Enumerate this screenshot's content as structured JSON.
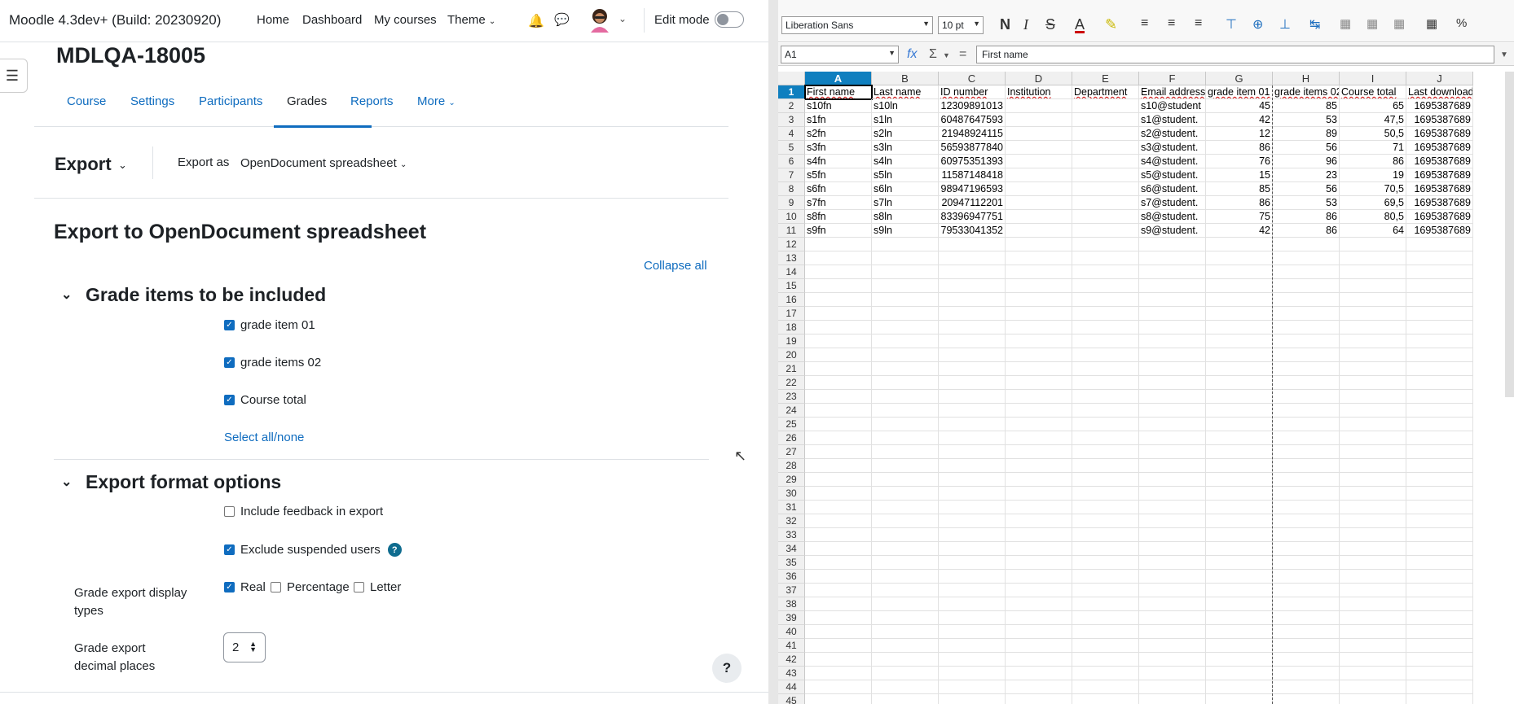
{
  "moodle": {
    "brand": "Moodle 4.3dev+ (Build: 20230920)",
    "nav": {
      "home": "Home",
      "dashboard": "Dashboard",
      "my_courses": "My courses",
      "theme": "Theme"
    },
    "edit_mode": "Edit mode",
    "course_title": "MDLQA-18005",
    "tabs": [
      "Course",
      "Settings",
      "Participants",
      "Grades",
      "Reports",
      "More"
    ],
    "active_tab": "Grades",
    "export_menu": "Export",
    "export_as_label": "Export as",
    "export_as_value": "OpenDocument spreadsheet",
    "page_heading": "Export to OpenDocument spreadsheet",
    "collapse_all": "Collapse all",
    "section_grade_items": "Grade items to be included",
    "grade_items": [
      {
        "label": "grade item 01",
        "checked": true
      },
      {
        "label": "grade items 02",
        "checked": true
      },
      {
        "label": "Course total",
        "checked": true
      }
    ],
    "select_all_none": "Select all/none",
    "section_format": "Export format options",
    "include_feedback": "Include feedback in export",
    "exclude_suspended": "Exclude suspended users",
    "display_types_label": "Grade export display types",
    "display_types": [
      {
        "label": "Real",
        "checked": true
      },
      {
        "label": "Percentage",
        "checked": false
      },
      {
        "label": "Letter",
        "checked": false
      }
    ],
    "decimal_places_label": "Grade export decimal places",
    "decimal_places_value": "2",
    "help": "?"
  },
  "spreadsheet": {
    "font_name": "Liberation Sans",
    "font_size": "10 pt",
    "name_box": "A1",
    "formula": "First name",
    "columns": [
      "A",
      "B",
      "C",
      "D",
      "E",
      "F",
      "G",
      "H",
      "I",
      "J"
    ],
    "rows": [
      [
        "First name",
        "Last name",
        "ID number",
        "Institution",
        "Department",
        "Email address",
        "grade item 01",
        "grade items 02",
        "Course total",
        "Last downloaded from"
      ],
      [
        "s10fn",
        "s10ln",
        "12309891013",
        "",
        "",
        "s10@student",
        "45",
        "85",
        "65",
        "1695387689"
      ],
      [
        "s1fn",
        "s1ln",
        "60487647593",
        "",
        "",
        "s1@student.",
        "42",
        "53",
        "47,5",
        "1695387689"
      ],
      [
        "s2fn",
        "s2ln",
        "21948924115",
        "",
        "",
        "s2@student.",
        "12",
        "89",
        "50,5",
        "1695387689"
      ],
      [
        "s3fn",
        "s3ln",
        "56593877840",
        "",
        "",
        "s3@student.",
        "86",
        "56",
        "71",
        "1695387689"
      ],
      [
        "s4fn",
        "s4ln",
        "60975351393",
        "",
        "",
        "s4@student.",
        "76",
        "96",
        "86",
        "1695387689"
      ],
      [
        "s5fn",
        "s5ln",
        "11587148418",
        "",
        "",
        "s5@student.",
        "15",
        "23",
        "19",
        "1695387689"
      ],
      [
        "s6fn",
        "s6ln",
        "98947196593",
        "",
        "",
        "s6@student.",
        "85",
        "56",
        "70,5",
        "1695387689"
      ],
      [
        "s7fn",
        "s7ln",
        "20947112201",
        "",
        "",
        "s7@student.",
        "86",
        "53",
        "69,5",
        "1695387689"
      ],
      [
        "s8fn",
        "s8ln",
        "83396947751",
        "",
        "",
        "s8@student.",
        "75",
        "86",
        "80,5",
        "1695387689"
      ],
      [
        "s9fn",
        "s9ln",
        "79533041352",
        "",
        "",
        "s9@student.",
        "42",
        "86",
        "64",
        "1695387689"
      ]
    ],
    "row_count_visible": 45
  },
  "colors": {
    "accent": "#0f6cbf",
    "sheet_selection": "#0f7fbf"
  }
}
